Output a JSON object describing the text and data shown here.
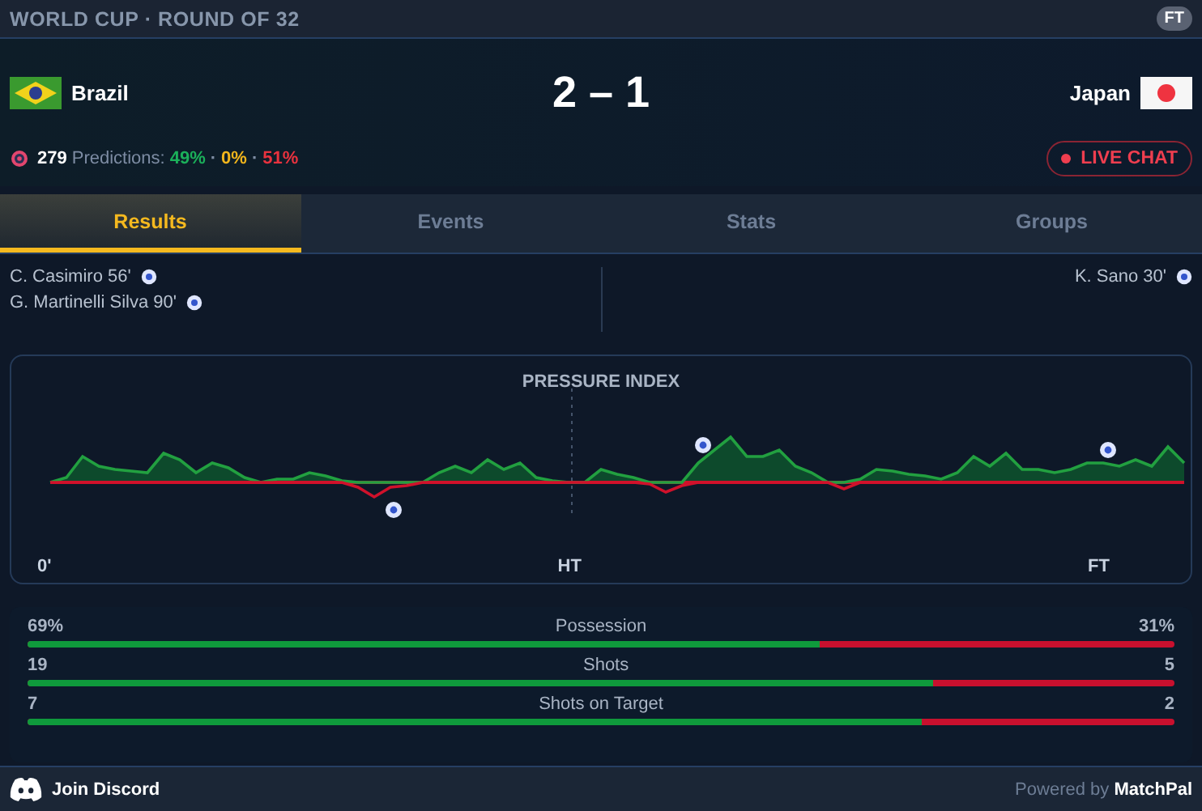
{
  "header": {
    "competition": "WORLD CUP · ROUND OF 32",
    "status": "FT"
  },
  "match": {
    "home": {
      "name": "Brazil"
    },
    "score": "2 – 1",
    "away": {
      "name": "Japan"
    }
  },
  "predictions": {
    "count": "279",
    "label": "Predictions:",
    "separator": "·",
    "home": "49%",
    "draw": "0%",
    "away": "51%"
  },
  "live_chat": "LIVE CHAT",
  "tabs": [
    {
      "label": "Results",
      "selected": true
    },
    {
      "label": "Events",
      "selected": false
    },
    {
      "label": "Stats",
      "selected": false
    },
    {
      "label": "Groups",
      "selected": false
    }
  ],
  "scorers": {
    "home": [
      "C. Casimiro 56'",
      "G. Martinelli Silva 90'"
    ],
    "away": [
      "K. Sano 30'"
    ]
  },
  "pressure": {
    "title": "PRESSURE INDEX",
    "axis": [
      "0'",
      "HT",
      "FT"
    ]
  },
  "stats": [
    {
      "home": "69%",
      "label": "Possession",
      "away": "31%",
      "level": 0.69
    },
    {
      "home": "19",
      "label": "Shots",
      "away": "5",
      "level": 0.79
    },
    {
      "home": "7",
      "label": "Shots on Target",
      "away": "2",
      "level": 0.78
    }
  ],
  "footer": {
    "discord": "Join Discord",
    "powered": "Powered by",
    "brand": "MatchPal"
  }
}
